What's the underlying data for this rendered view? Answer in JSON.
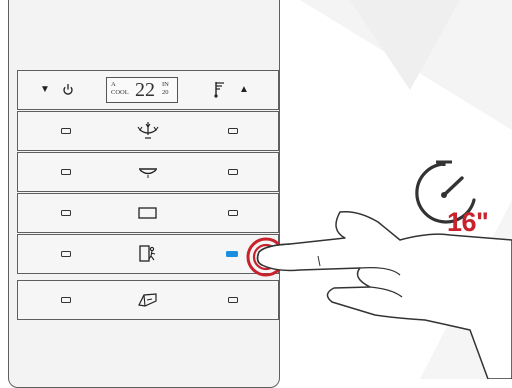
{
  "control_row": {
    "mode_line1": "A",
    "mode_line2": "COOL",
    "temperature": "22",
    "in_line1": "IN",
    "in_line2": "20"
  },
  "timer": {
    "duration": "16\""
  },
  "colors": {
    "accent_red": "#c8232c",
    "active_led": "#1c8ee0"
  },
  "rows": [
    {
      "icon": "chandelier-icon"
    },
    {
      "icon": "ceiling-lamp-icon"
    },
    {
      "icon": "rectangle-light-icon"
    },
    {
      "icon": "door-exit-icon",
      "active": true
    },
    {
      "icon": "curtain-icon"
    }
  ]
}
